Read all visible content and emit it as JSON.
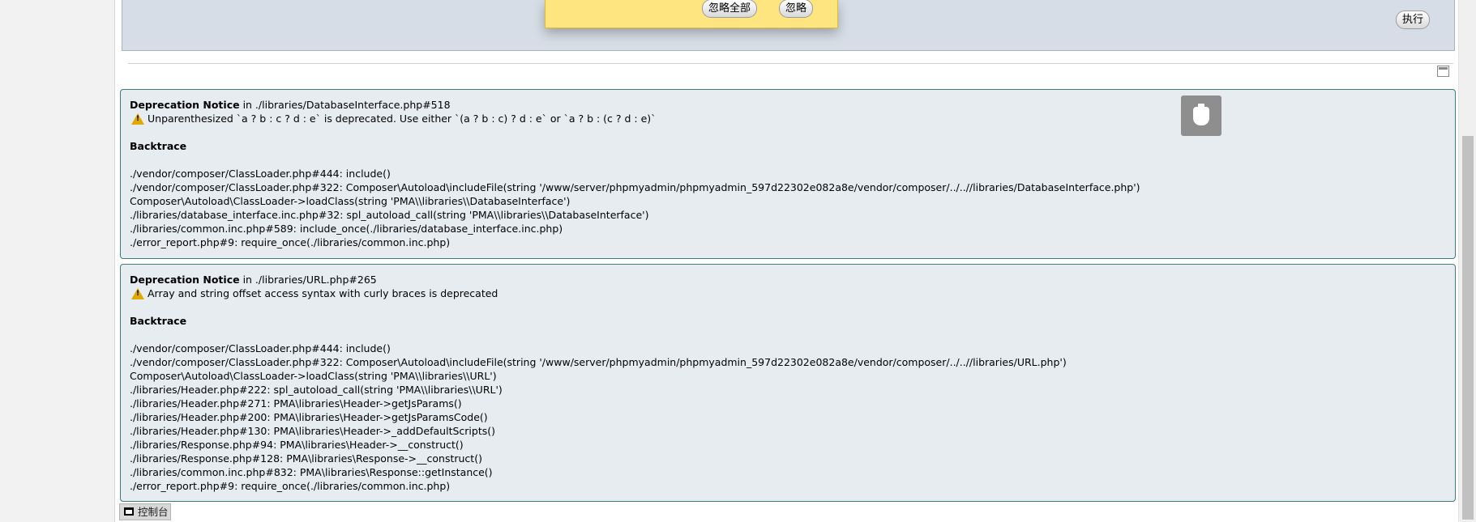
{
  "query_panel": {
    "execute_label": "执行"
  },
  "error_popup": {
    "ignore_all_label": "忽略全部",
    "ignore_label": "忽略"
  },
  "notices": [
    {
      "title": "Deprecation Notice",
      "location": " in ./libraries/DatabaseInterface.php#518",
      "message": "Unparenthesized `a ? b : c ? d : e` is deprecated. Use either `(a ? b : c) ? d : e` or `a ? b : (c ? d : e)`",
      "backtrace_title": "Backtrace",
      "trace": [
        "./vendor/composer/ClassLoader.php#444: include()",
        "./vendor/composer/ClassLoader.php#322: Composer\\Autoload\\includeFile(string '/www/server/phpmyadmin/phpmyadmin_597d22302e082a8e/vendor/composer/../..//libraries/DatabaseInterface.php')",
        "Composer\\Autoload\\ClassLoader->loadClass(string 'PMA\\\\libraries\\\\DatabaseInterface')",
        "./libraries/database_interface.inc.php#32: spl_autoload_call(string 'PMA\\\\libraries\\\\DatabaseInterface')",
        "./libraries/common.inc.php#589: include_once(./libraries/database_interface.inc.php)",
        "./error_report.php#9: require_once(./libraries/common.inc.php)"
      ]
    },
    {
      "title": "Deprecation Notice",
      "location": " in ./libraries/URL.php#265",
      "message": "Array and string offset access syntax with curly braces is deprecated",
      "backtrace_title": "Backtrace",
      "trace": [
        "./vendor/composer/ClassLoader.php#444: include()",
        "./vendor/composer/ClassLoader.php#322: Composer\\Autoload\\includeFile(string '/www/server/phpmyadmin/phpmyadmin_597d22302e082a8e/vendor/composer/../..//libraries/URL.php')",
        "Composer\\Autoload\\ClassLoader->loadClass(string 'PMA\\\\libraries\\\\URL')",
        "./libraries/Header.php#222: spl_autoload_call(string 'PMA\\\\libraries\\\\URL')",
        "./libraries/Header.php#271: PMA\\libraries\\Header->getJsParams()",
        "./libraries/Header.php#200: PMA\\libraries\\Header->getJsParamsCode()",
        "./libraries/Header.php#130: PMA\\libraries\\Header->_addDefaultScripts()",
        "./libraries/Response.php#94: PMA\\libraries\\Header->__construct()",
        "./libraries/Response.php#128: PMA\\libraries\\Response->__construct()",
        "./libraries/common.inc.php#832: PMA\\libraries\\Response::getInstance()",
        "./error_report.php#9: require_once(./libraries/common.inc.php)"
      ]
    }
  ],
  "console": {
    "label": "控制台"
  },
  "icons": {
    "warning": "warning-icon",
    "sql": "sql-query-icon",
    "usb": "usb-drive-icon",
    "console": "console-icon"
  },
  "colors": {
    "panel_bg": "#d6dde6",
    "popup_bg": "#ffe57f",
    "notice_bg": "#e7ecf1",
    "notice_border": "#3d7a7a",
    "warning": "#e0a800"
  }
}
